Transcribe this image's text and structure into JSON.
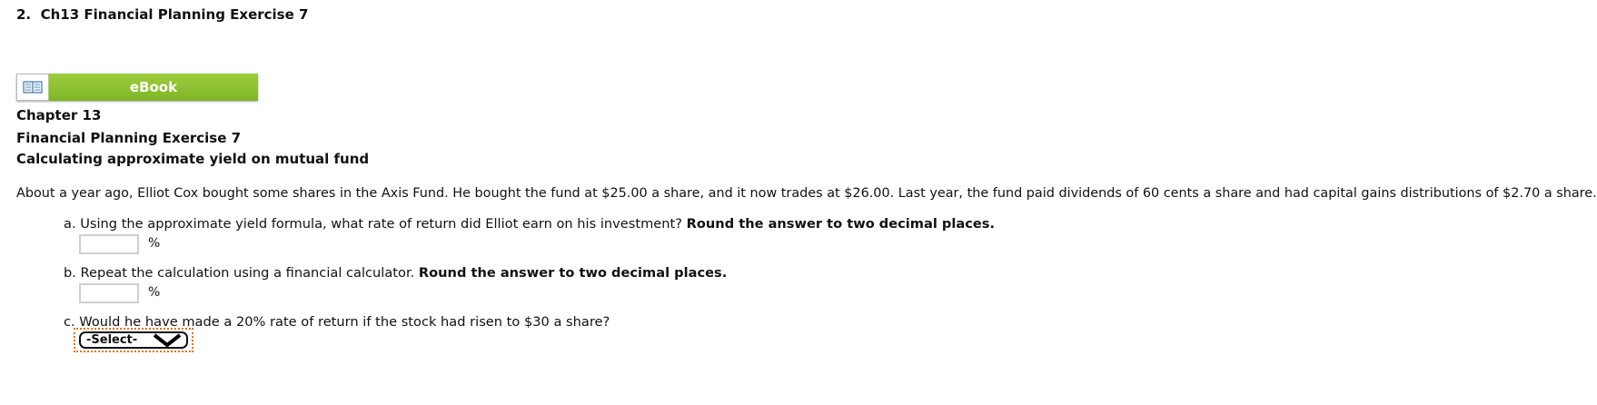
{
  "question": {
    "number": "2.",
    "title": "Ch13 Financial Planning Exercise 7"
  },
  "ebook": {
    "icon": "book-icon",
    "label": "eBook"
  },
  "header": {
    "chapter": "Chapter 13",
    "exercise": "Financial Planning Exercise 7",
    "subtitle": "Calculating approximate yield on mutual fund"
  },
  "intro": "About a year ago, Elliot Cox bought some shares in the Axis Fund. He bought the fund at $25.00 a share, and it now trades at $26.00. Last year, the fund paid dividends of 60 cents a share and had capital gains distributions of $2.70 a share.",
  "parts": {
    "a": {
      "text": "a. Using the approximate yield formula, what rate of return did Elliot earn on his investment? ",
      "emphasis": "Round the answer to two decimal places.",
      "value": "",
      "unit": "%"
    },
    "b": {
      "text": "b. Repeat the calculation using a financial calculator. ",
      "emphasis": "Round the answer to two decimal places.",
      "value": "",
      "unit": "%"
    },
    "c": {
      "text": "c. Would he have made a 20% rate of return if the stock had risen to $30 a share?",
      "select_value": "-Select-"
    }
  },
  "colors": {
    "ebook_green": "#8cc234",
    "focus_outline": "#e0701a"
  }
}
